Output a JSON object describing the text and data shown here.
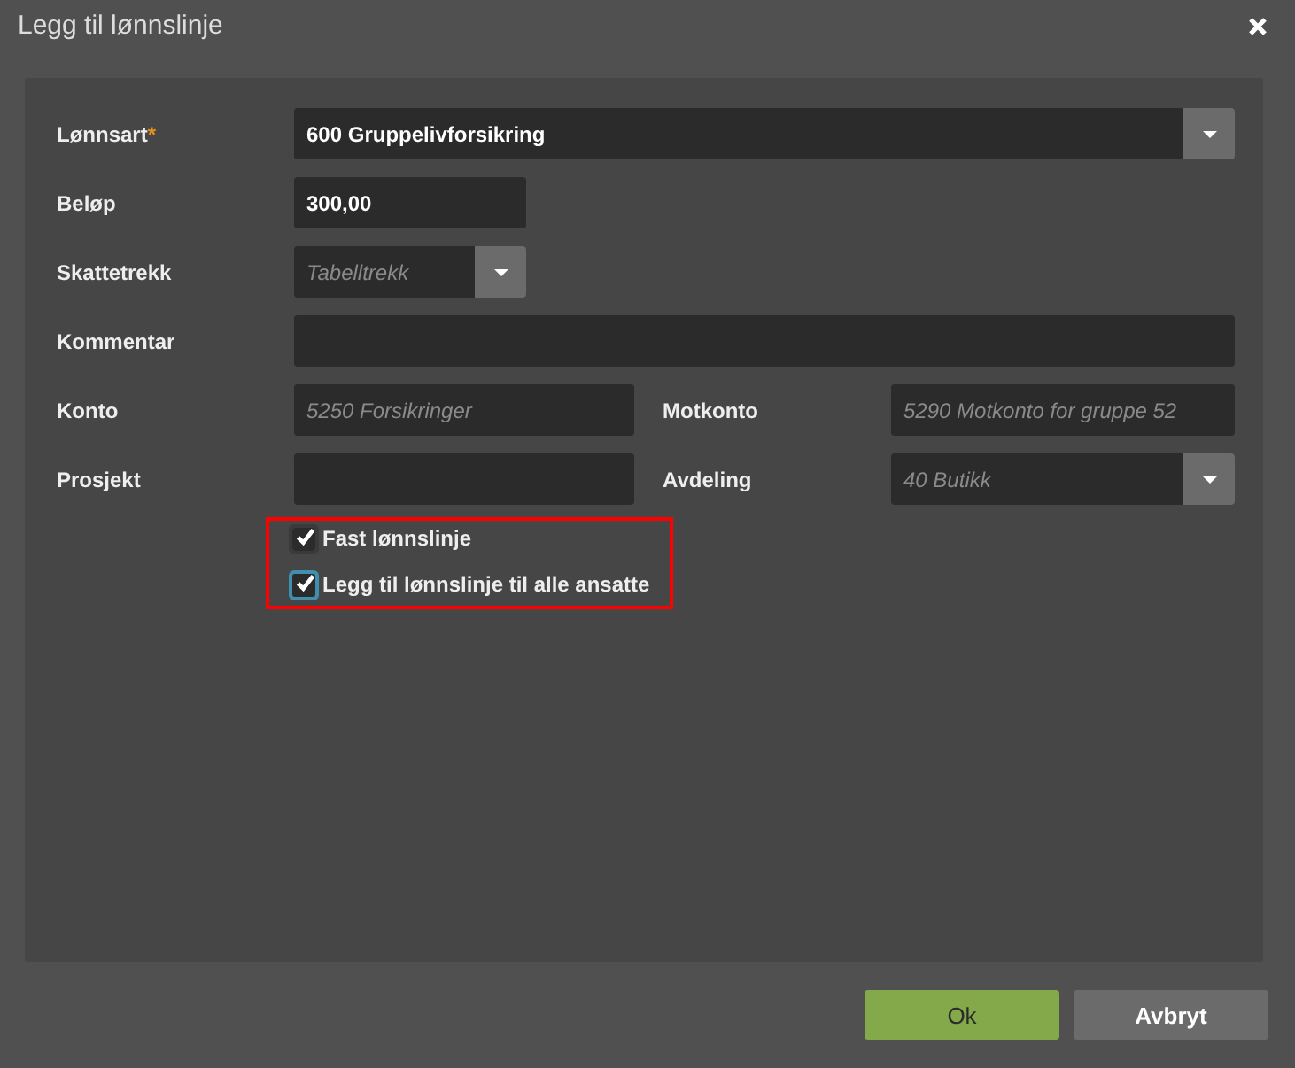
{
  "window": {
    "title": "Legg til lønnslinje"
  },
  "rows": [
    {
      "kind": "full",
      "label": "Lønnsart",
      "required_mark": "*",
      "field": {
        "kind": "select",
        "value": "600 Gruppelivforsikring"
      }
    },
    {
      "kind": "short",
      "label": "Beløp",
      "field": {
        "kind": "input",
        "value": "300,00"
      }
    },
    {
      "kind": "short",
      "label": "Skattetrekk",
      "field": {
        "kind": "select",
        "placeholder": "Tabelltrekk"
      }
    },
    {
      "kind": "full",
      "label": "Kommentar",
      "field": {
        "kind": "input"
      }
    },
    {
      "kind": "pair",
      "label": "Konto",
      "field": {
        "kind": "input",
        "placeholder": "5250 Forsikringer"
      },
      "label2": "Motkonto",
      "field2": {
        "kind": "input",
        "placeholder": "5290 Motkonto for gruppe 52"
      }
    },
    {
      "kind": "pair",
      "label": "Prosjekt",
      "field": {
        "kind": "input"
      },
      "label2": "Avdeling",
      "field2": {
        "kind": "select",
        "placeholder": "40 Butikk"
      }
    }
  ],
  "checkboxes": [
    {
      "label": "Fast lønnslinje",
      "checked": true,
      "focused": false
    },
    {
      "label": "Legg til lønnslinje til alle ansatte",
      "checked": true,
      "focused": true
    }
  ],
  "highlight": true,
  "buttons": [
    {
      "label": "Ok",
      "kind": "primary"
    },
    {
      "label": "Avbryt",
      "kind": "secondary"
    }
  ]
}
